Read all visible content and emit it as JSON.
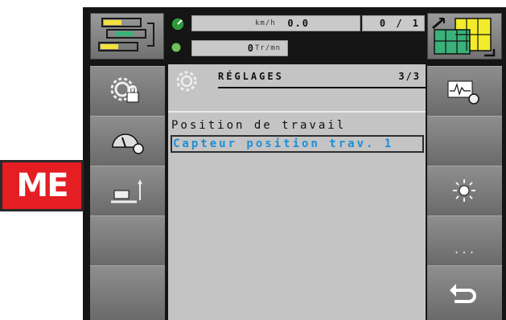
{
  "brand": {
    "logo_text": "ME",
    "logo_color": "#e41e23"
  },
  "top_bar": {
    "speed": {
      "value": "0.0",
      "unit": "km/h"
    },
    "counter": {
      "value": "0 / 1"
    },
    "rotation": {
      "value": "0",
      "unit": "Tr/mn"
    }
  },
  "panel": {
    "title": "RÉGLAGES",
    "page": "3/3",
    "items": [
      {
        "label": "Position de travail",
        "selected": false
      },
      {
        "label": "Capteur position trav. 1",
        "selected": true
      }
    ]
  },
  "left_buttons": [
    {
      "icon": "gear-lock-icon"
    },
    {
      "icon": "gauge-gear-icon"
    },
    {
      "icon": "machine-position-icon"
    },
    {
      "icon": ""
    },
    {
      "icon": ""
    }
  ],
  "right_buttons": [
    {
      "icon": "signal-gear-icon"
    },
    {
      "icon": ""
    },
    {
      "icon": "brightness-icon"
    },
    {
      "icon": "more-icon",
      "label": "..."
    },
    {
      "icon": "back-arrow-icon"
    }
  ],
  "colors": {
    "accent_text": "#1b8fd8",
    "panel_bg": "#c4c4c4",
    "button_bg": "#7c7c7c"
  }
}
